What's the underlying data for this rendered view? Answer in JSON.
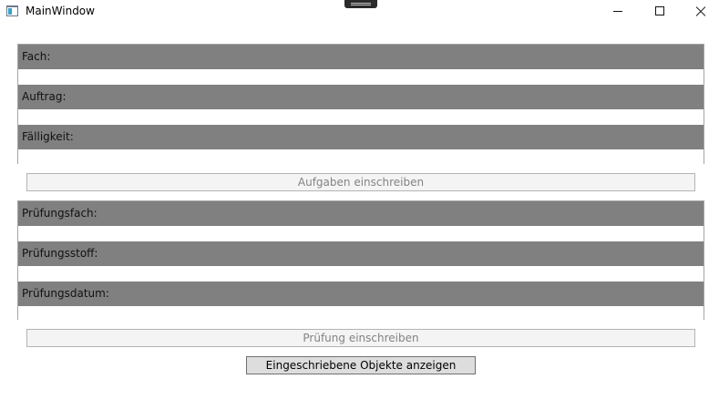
{
  "window": {
    "title": "MainWindow"
  },
  "icons": {
    "app": "app-window-icon",
    "minimize": "minimize-icon",
    "maximize": "maximize-icon",
    "close": "close-icon"
  },
  "aufgaben": {
    "fach_label": "Fach:",
    "fach_value": "",
    "auftrag_label": "Auftrag:",
    "auftrag_value": "",
    "faelligkeit_label": "Fälligkeit:",
    "faelligkeit_value": "",
    "submit_label": "Aufgaben einschreiben"
  },
  "pruefung": {
    "fach_label": "Prüfungsfach:",
    "fach_value": "",
    "stoff_label": "Prüfungsstoff:",
    "stoff_value": "",
    "datum_label": "Prüfungsdatum:",
    "datum_value": "",
    "submit_label": "Prüfung einschreiben"
  },
  "actions": {
    "show_objects_label": "Eingeschriebene Objekte anzeigen"
  },
  "colors": {
    "label_bar": "#808080",
    "border": "#a5a5a5",
    "disabled_text": "#838383",
    "button_face": "#dddddd"
  }
}
